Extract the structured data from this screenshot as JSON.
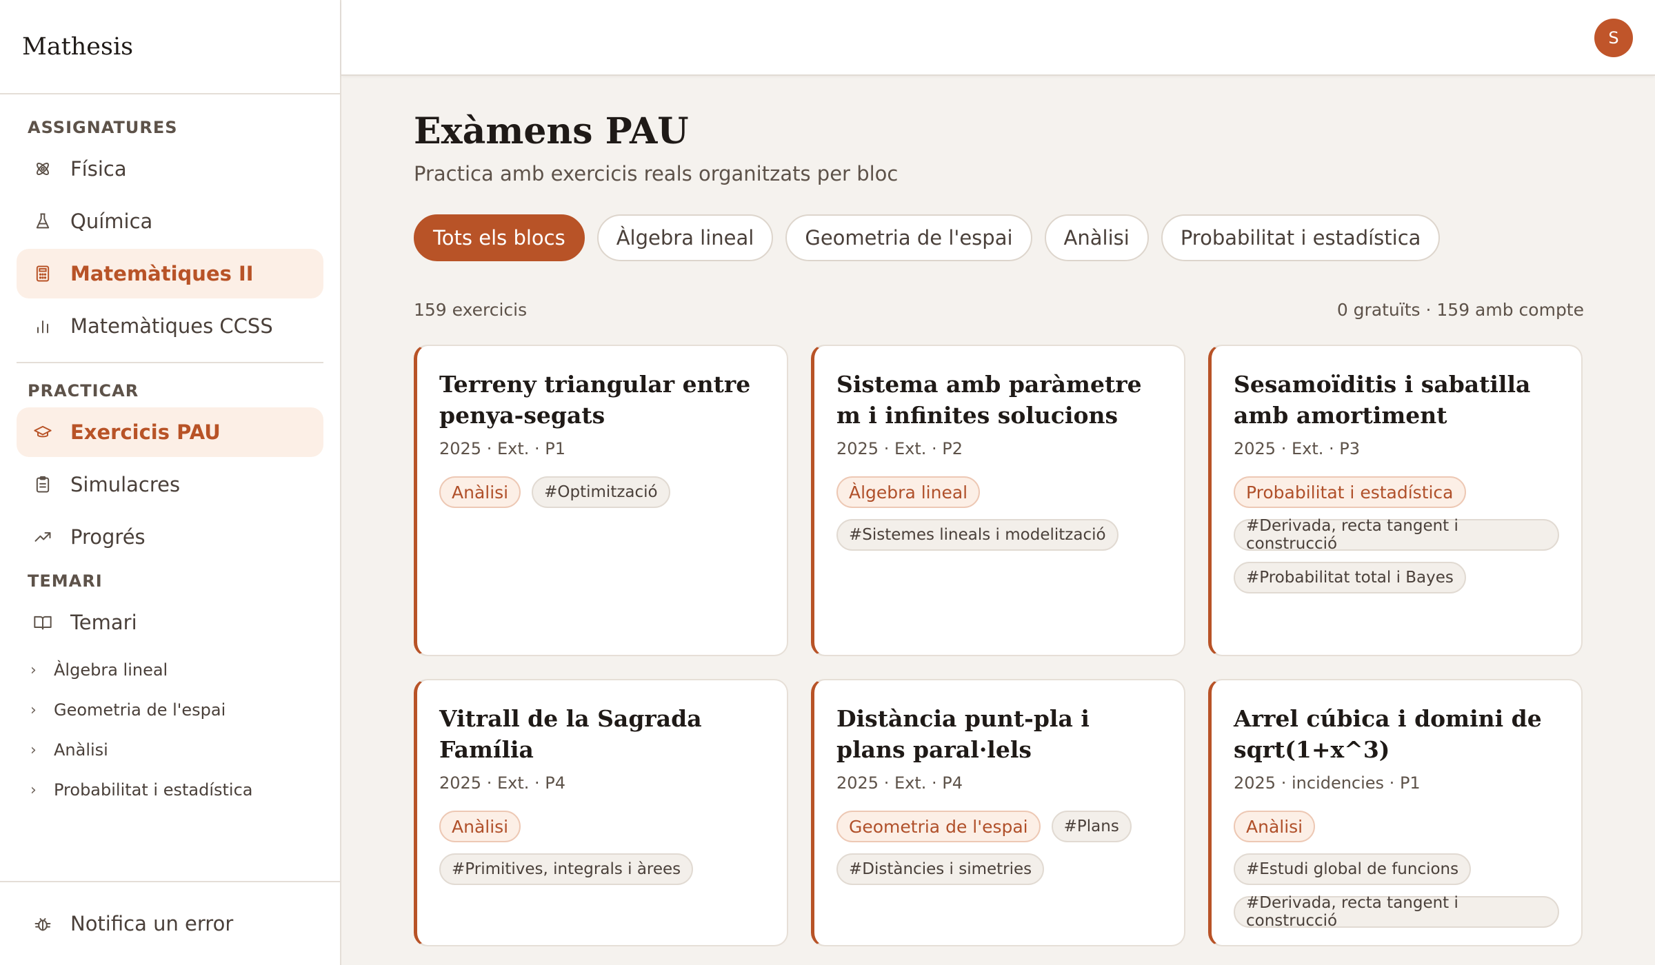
{
  "brand": "Mathesis",
  "user": {
    "avatar_initial": "S"
  },
  "sidebar": {
    "subjects_title": "ASSIGNATURES",
    "subjects": [
      {
        "label": "Física",
        "icon": "atom-icon"
      },
      {
        "label": "Química",
        "icon": "flask-icon"
      },
      {
        "label": "Matemàtiques II",
        "icon": "calculator-icon",
        "active": true
      },
      {
        "label": "Matemàtiques CCSS",
        "icon": "bar-chart-icon"
      }
    ],
    "practice_title": "PRACTICAR",
    "practice": [
      {
        "label": "Exercicis PAU",
        "icon": "graduation-cap-icon",
        "active": true
      },
      {
        "label": "Simulacres",
        "icon": "clipboard-icon"
      },
      {
        "label": "Progrés",
        "icon": "trending-up-icon"
      }
    ],
    "syllabus_title": "TEMARI",
    "syllabus_link": {
      "label": "Temari",
      "icon": "book-icon"
    },
    "syllabus_items": [
      "Àlgebra lineal",
      "Geometria de l'espai",
      "Anàlisi",
      "Probabilitat i estadística"
    ],
    "report": {
      "label": "Notifica un error",
      "icon": "bug-icon"
    }
  },
  "main": {
    "title": "Exàmens PAU",
    "subtitle": "Practica amb exercicis reals organitzats per bloc",
    "filters": [
      "Tots els blocs",
      "Àlgebra lineal",
      "Geometria de l'espai",
      "Anàlisi",
      "Probabilitat i estadística"
    ],
    "active_filter": 0,
    "count_left": "159 exercicis",
    "count_right": "0 gratuïts · 159 amb compte",
    "cards": [
      {
        "title": "Terreny triangular entre penya-segats",
        "meta": "2025 · Ext. · P1",
        "block": "Anàlisi",
        "topics": [
          "#Optimització"
        ]
      },
      {
        "title": "Sistema amb paràmetre m i infinites solucions",
        "meta": "2025 · Ext. · P2",
        "block": "Àlgebra lineal",
        "topics": [
          "#Sistemes lineals i modelització"
        ]
      },
      {
        "title": "Sesamoïditis i sabatilla amb amortiment",
        "meta": "2025 · Ext. · P3",
        "block": "Probabilitat i estadística",
        "topics": [
          "#Derivada, recta tangent i construcció",
          "#Probabilitat total i Bayes"
        ]
      },
      {
        "title": "Vitrall de la Sagrada Família",
        "meta": "2025 · Ext. · P4",
        "block": "Anàlisi",
        "topics": [
          "#Primitives, integrals i àrees"
        ]
      },
      {
        "title": "Distància punt-pla i plans paral·lels",
        "meta": "2025 · Ext. · P4",
        "block": "Geometria de l'espai",
        "topics": [
          "#Plans",
          "#Distàncies i simetries"
        ]
      },
      {
        "title": "Arrel cúbica i domini de sqrt(1+x^3)",
        "meta": "2025 · incidencies · P1",
        "block": "Anàlisi",
        "topics": [
          "#Estudi global de funcions",
          "#Derivada, recta tangent i construcció"
        ]
      }
    ]
  },
  "colors": {
    "accent": "#b85327",
    "accent_soft": "#fcefe6",
    "background": "#f5f2ee"
  }
}
